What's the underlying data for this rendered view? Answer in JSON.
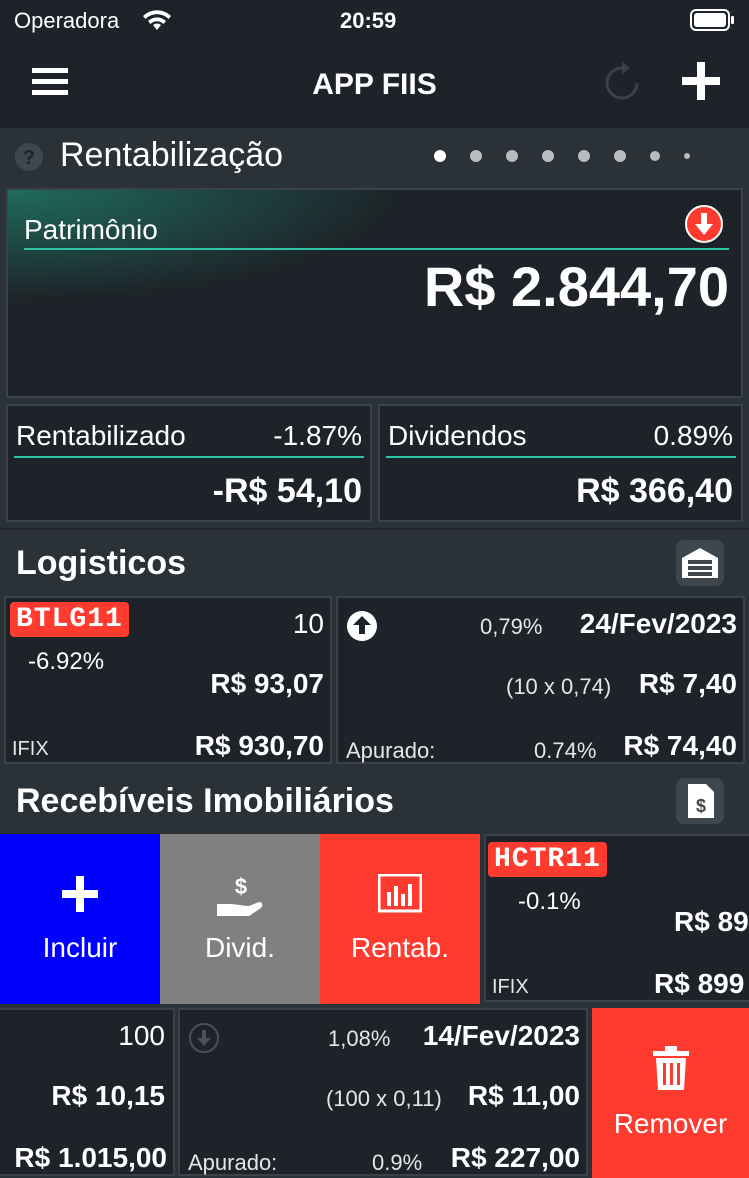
{
  "status": {
    "carrier": "Operadora",
    "time": "20:59"
  },
  "nav": {
    "title": "APP FIIS",
    "menu_icon": "menu-icon",
    "refresh_icon": "refresh-icon",
    "add_icon": "plus-icon"
  },
  "rent": {
    "section_title": "Rentabilização",
    "patrimonio_label": "Patrimônio",
    "patrimonio_value": "R$ 2.844,70",
    "rentabilizado_label": "Rentabilizado",
    "rentabilizado_pct": "-1.87%",
    "rentabilizado_value": "-R$ 54,10",
    "dividendos_label": "Dividendos",
    "dividendos_pct": "0.89%",
    "dividendos_value": "R$ 366,40"
  },
  "logisticos": {
    "section_title": "Logisticos",
    "ticker": "BTLG11",
    "change": "-6.92%",
    "qty": "10",
    "price": "R$ 93,07",
    "index": "IFIX",
    "total": "R$ 930,70",
    "div_pct": "0,79%",
    "div_date": "24/Fev/2023",
    "div_calc": "(10 x 0,74)",
    "div_value": "R$ 7,40",
    "apurado_label": "Apurado:",
    "apurado_pct": "0.74%",
    "apurado_value": "R$ 74,40"
  },
  "recebiveis": {
    "section_title": "Recebíveis Imobiliários",
    "ticker": "HCTR11",
    "change": "-0.1%",
    "price_partial": "R$ 89",
    "index": "IFIX",
    "total_partial": "R$ 899",
    "actions": {
      "incluir": "Incluir",
      "divid": "Divid.",
      "rentab": "Rentab."
    },
    "qty": "100",
    "price": "R$ 10,15",
    "total": "R$ 1.015,00",
    "div_pct": "1,08%",
    "div_date": "14/Fev/2023",
    "div_calc": "(100 x 0,11)",
    "div_value": "R$ 11,00",
    "apurado_label": "Apurado:",
    "apurado_pct": "0.9%",
    "apurado_value": "R$ 227,00",
    "remover": "Remover"
  },
  "colors": {
    "background": "#1d2328",
    "accent": "#2ec4a5",
    "danger": "#ff3b30",
    "blue": "#0000ff",
    "gray": "#808080"
  }
}
